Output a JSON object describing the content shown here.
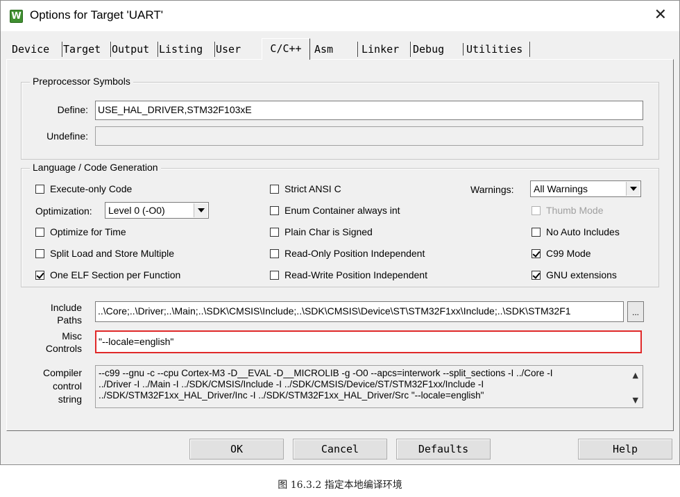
{
  "window": {
    "title": "Options for Target 'UART'",
    "icon": "keil-uvision-icon",
    "close_glyph": "✕"
  },
  "tabs": [
    {
      "label": "Device"
    },
    {
      "label": "Target"
    },
    {
      "label": "Output"
    },
    {
      "label": "Listing"
    },
    {
      "label": "User"
    },
    {
      "label": "C/C++",
      "active": true
    },
    {
      "label": "Asm"
    },
    {
      "label": "Linker"
    },
    {
      "label": "Debug"
    },
    {
      "label": "Utilities"
    }
  ],
  "preprocessor": {
    "legend": "Preprocessor Symbols",
    "define_label": "Define:",
    "define_value": "USE_HAL_DRIVER,STM32F103xE",
    "undefine_label": "Undefine:",
    "undefine_value": ""
  },
  "codegen": {
    "legend": "Language / Code Generation",
    "execute_only": {
      "label": "Execute-only Code",
      "checked": false
    },
    "optimization_label": "Optimization:",
    "optimization_value": "Level 0 (-O0)",
    "optimize_time": {
      "label": "Optimize for Time",
      "checked": false
    },
    "split_load": {
      "label": "Split Load and Store Multiple",
      "checked": false
    },
    "one_elf": {
      "label": "One ELF Section per Function",
      "checked": true
    },
    "strict_ansi": {
      "label": "Strict ANSI C",
      "checked": false
    },
    "enum_container": {
      "label": "Enum Container always int",
      "checked": false
    },
    "plain_char": {
      "label": "Plain Char is Signed",
      "checked": false
    },
    "ro_pi": {
      "label": "Read-Only Position Independent",
      "checked": false
    },
    "rw_pi": {
      "label": "Read-Write Position Independent",
      "checked": false
    },
    "warnings_label": "Warnings:",
    "warnings_value": "All Warnings",
    "thumb_mode": {
      "label": "Thumb Mode",
      "checked": false,
      "disabled": true
    },
    "no_auto_includes": {
      "label": "No Auto Includes",
      "checked": false
    },
    "c99_mode": {
      "label": "C99 Mode",
      "checked": true
    },
    "gnu_extensions": {
      "label": "GNU extensions",
      "checked": true
    }
  },
  "include_paths": {
    "label_line1": "Include",
    "label_line2": "Paths",
    "value": "..\\Core;..\\Driver;..\\Main;..\\SDK\\CMSIS\\Include;..\\SDK\\CMSIS\\Device\\ST\\STM32F1xx\\Include;..\\SDK\\STM32F1",
    "browse_label": "..."
  },
  "misc_controls": {
    "label_line1": "Misc",
    "label_line2": "Controls",
    "value": "\"--locale=english\""
  },
  "compiler_string": {
    "label_line1": "Compiler",
    "label_line2": "control",
    "label_line3": "string",
    "lines": [
      "--c99 --gnu -c --cpu Cortex-M3 -D__EVAL -D__MICROLIB -g -O0 --apcs=interwork --split_sections -I ../Core -I",
      "../Driver -I ../Main -I ../SDK/CMSIS/Include -I ../SDK/CMSIS/Device/ST/STM32F1xx/Include -I",
      "../SDK/STM32F1xx_HAL_Driver/Inc -I ../SDK/STM32F1xx_HAL_Driver/Src \"--locale=english\""
    ]
  },
  "buttons": {
    "ok": "OK",
    "cancel": "Cancel",
    "defaults": "Defaults",
    "help": "Help"
  },
  "caption": "图 16.3.2 指定本地编译环境",
  "colors": {
    "window_bg": "#f0f0f0",
    "highlight_border": "#e02828",
    "icon_green": "#3f8f30"
  }
}
